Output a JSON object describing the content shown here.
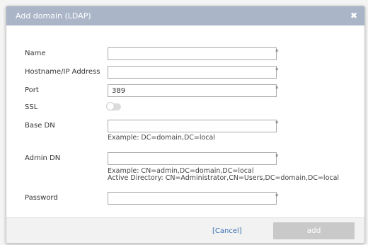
{
  "dialog": {
    "title": "Add domain (LDAP)",
    "close_icon": "close-icon"
  },
  "form": {
    "name": {
      "label": "Name",
      "value": "",
      "required_mark": "*"
    },
    "hostname": {
      "label": "Hostname/IP Address",
      "value": "",
      "required_mark": "*"
    },
    "port": {
      "label": "Port",
      "value": "389",
      "required_mark": "*"
    },
    "ssl": {
      "label": "SSL",
      "enabled": false
    },
    "base_dn": {
      "label": "Base DN",
      "value": "",
      "required_mark": "*",
      "hint": "Example: DC=domain,DC=local"
    },
    "admin_dn": {
      "label": "Admin DN",
      "value": "",
      "required_mark": "*",
      "hint_line1": "Example: CN=admin,DC=domain,DC=local",
      "hint_line2": "Active Directory: CN=Administrator,CN=Users,DC=domain,DC=local"
    },
    "password": {
      "label": "Password",
      "value": "",
      "required_mark": "*"
    }
  },
  "footer": {
    "cancel_label": "[Cancel]",
    "add_label": "add"
  },
  "colors": {
    "titlebar": "#aab6c8",
    "link": "#3a6fb0",
    "disabled_button": "#c9c9c9"
  }
}
